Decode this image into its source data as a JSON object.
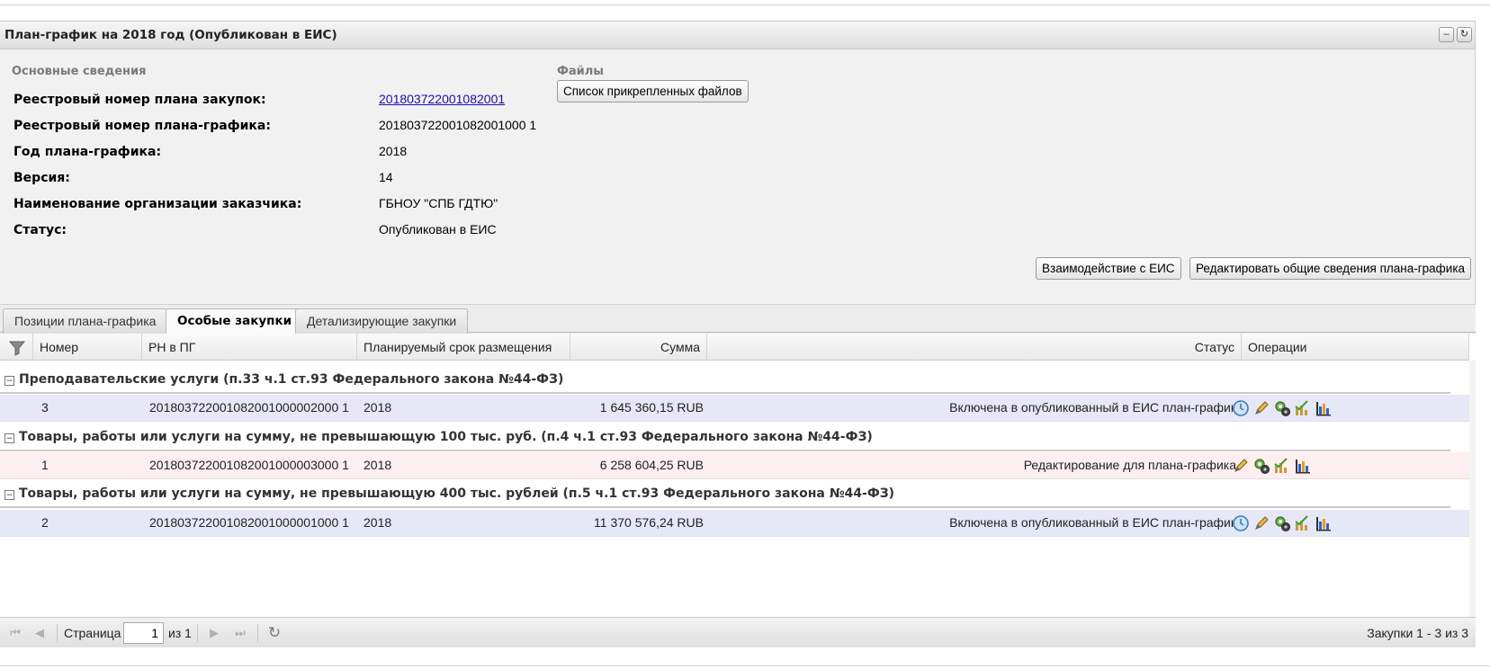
{
  "panel": {
    "title": "План-график на 2018 год (Опубликован в ЕИС)",
    "tools": [
      "collapse-icon",
      "refresh-icon"
    ]
  },
  "general": {
    "section_title": "Основные сведения",
    "fields": [
      {
        "label": "Реестровый номер плана закупок:",
        "value": "201803722001082001"
      },
      {
        "label": "Реестровый номер плана-графика:",
        "value": "201803722001082001000 1"
      },
      {
        "label": "Год плана-графика:",
        "value": "2018"
      },
      {
        "label": "Версия:",
        "value": "14"
      },
      {
        "label": "Наименование организации заказчика:",
        "value": "ГБНОУ \"СПБ ГДТЮ\""
      },
      {
        "label": "Статус:",
        "value": "Опубликован в ЕИС"
      }
    ]
  },
  "files": {
    "section_title": "Файлы",
    "button_label": "Список прикрепленных файлов"
  },
  "actions": {
    "eis_label": "Взаимодействие с ЕИС",
    "edit_label": "Редактировать общие сведения плана-графика"
  },
  "tabs": [
    {
      "label": "Позиции плана-графика",
      "active": false
    },
    {
      "label": "Особые закупки",
      "active": true
    },
    {
      "label": "Детализирующие закупки",
      "active": false
    }
  ],
  "grid": {
    "columns": {
      "number": "Номер",
      "rn": "РН в ПГ",
      "planned": "Планируемый срок размещения",
      "sum": "Сумма",
      "status": "Статус",
      "operations": "Операции"
    },
    "groups": [
      {
        "title": "Преподавательские услуги (п.33 ч.1 ст.93 Федерального закона №44-ФЗ)",
        "row": {
          "number": "3",
          "rn": "201803722001082001000002000 1",
          "planned": "2018",
          "sum": "1 645 360,15 RUB",
          "status": "Включена в опубликованный в ЕИС план-график",
          "style": "blue",
          "ops": [
            "history-icon",
            "edit-pencil-icon",
            "gears-icon",
            "approve-chart-icon",
            "bar-chart-icon"
          ]
        }
      },
      {
        "title": "Товары, работы или услуги на сумму, не превышающую 100 тыс. руб. (п.4 ч.1 ст.93 Федерального закона №44-ФЗ)",
        "row": {
          "number": "1",
          "rn": "201803722001082001000003000 1",
          "planned": "2018",
          "sum": "6 258 604,25 RUB",
          "status": "Редактирование для плана-графика",
          "style": "pink",
          "ops": [
            "edit-pencil-icon",
            "gears-icon",
            "approve-chart-icon",
            "bar-chart-icon"
          ]
        }
      },
      {
        "title": "Товары, работы или услуги на сумму, не превышающую 400 тыс. рублей (п.5 ч.1 ст.93 Федерального закона №44-ФЗ)",
        "row": {
          "number": "2",
          "rn": "201803722001082001000001000 1",
          "planned": "2018",
          "sum": "11 370 576,24 RUB",
          "status": "Включена в опубликованный в ЕИС план-график",
          "style": "blue",
          "ops": [
            "history-icon",
            "edit-pencil-icon",
            "gears-icon",
            "approve-chart-icon",
            "bar-chart-icon"
          ]
        }
      }
    ]
  },
  "pager": {
    "page_label": "Страница",
    "page_value": "1",
    "of_label": "из 1",
    "summary": "Закупки 1 - 3 из 3"
  },
  "colors": {
    "row_blue": "#e6e8f8",
    "row_pink": "#fdeef0",
    "link": "#1a0dab"
  }
}
